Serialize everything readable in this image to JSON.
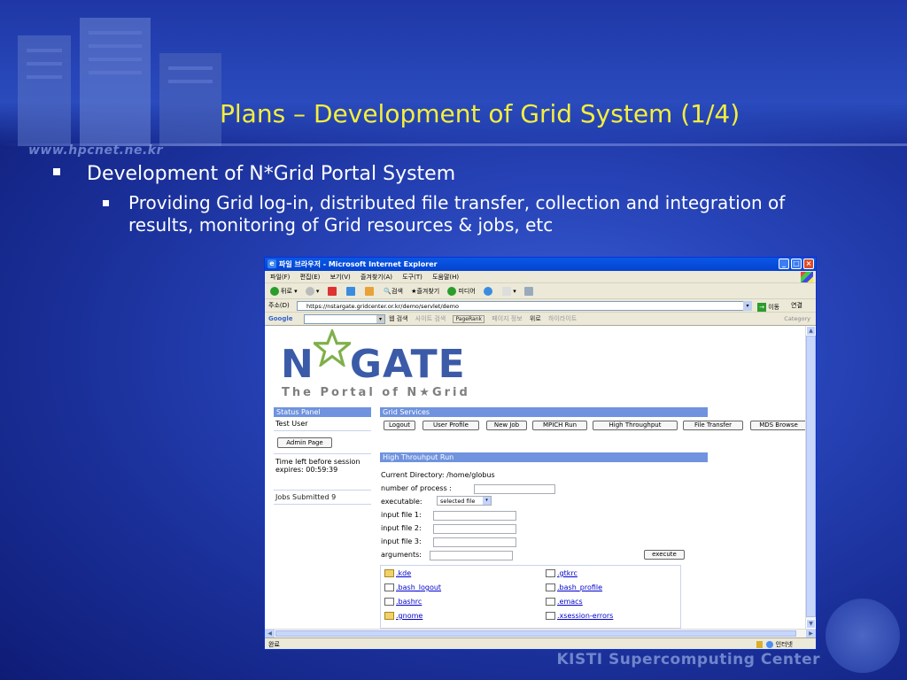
{
  "slide": {
    "title": "Plans – Development of Grid System (1/4)",
    "watermark": "www.hpcnet.ne.kr",
    "footer": "KISTI Supercomputing Center",
    "bullet1": "Development of N*Grid Portal System",
    "bullet2": "Providing Grid log-in, distributed file transfer, collection and integration of results, monitoring of Grid resources & jobs, etc"
  },
  "browser": {
    "title": "파일 브라우저 - Microsoft Internet Explorer",
    "menu": [
      "파일(F)",
      "편집(E)",
      "보기(V)",
      "즐겨찾기(A)",
      "도구(T)",
      "도움말(H)"
    ],
    "toolbar": [
      "뒤로",
      "검색",
      "즐겨찾기",
      "미디어"
    ],
    "address_label": "주소(D)",
    "address": "https://nstargate.gridcenter.or.kr/demo/servlet/demo",
    "go_label": "이동",
    "links_label": "연결",
    "google_label": "Google",
    "google_items": [
      "웹 검색",
      "사이트 검색",
      "PageRank",
      "페이지 정보",
      "위로",
      "하이라이트"
    ],
    "category_label": "Category",
    "status_text": "완료",
    "zone_text": "인터넷"
  },
  "portal": {
    "logo_main": "N GATE",
    "logo_sub": "The Portal of N★Grid",
    "status_panel": {
      "header": "Status Panel",
      "user": "Test User",
      "admin_button": "Admin Page",
      "time_left": "Time left before session expires: 00:59:39",
      "jobs": "Jobs Submitted 9"
    },
    "grid_services": {
      "header": "Grid Services",
      "buttons": [
        "Logout",
        "User Profile",
        "New Job",
        "MPICH Run",
        "High Throughput",
        "File Transfer",
        "MDS Browse"
      ]
    },
    "run_form": {
      "header": "High Throuhput Run",
      "current_dir_label": "Current Directory:",
      "current_dir_value": "/home/globus",
      "num_process_label": "number of process :",
      "executable_label": "executable:",
      "executable_value": "selected file",
      "input1_label": "input file 1:",
      "input2_label": "input file 2:",
      "input3_label": "input file 3:",
      "arguments_label": "arguments:",
      "execute_button": "execute"
    },
    "files": [
      {
        "name": ".kde",
        "type": "folder"
      },
      {
        "name": ".gtkrc",
        "type": "file"
      },
      {
        "name": ".bash_logout",
        "type": "file"
      },
      {
        "name": ".bash_profile",
        "type": "file"
      },
      {
        "name": ".bashrc",
        "type": "file"
      },
      {
        "name": ".emacs",
        "type": "file"
      },
      {
        "name": ".gnome",
        "type": "folder"
      },
      {
        "name": ".xsession-errors",
        "type": "file"
      }
    ]
  },
  "colors": {
    "title": "#f4ef3c",
    "panel_header": "#6f93de",
    "slide_bg": "#2744b8"
  }
}
